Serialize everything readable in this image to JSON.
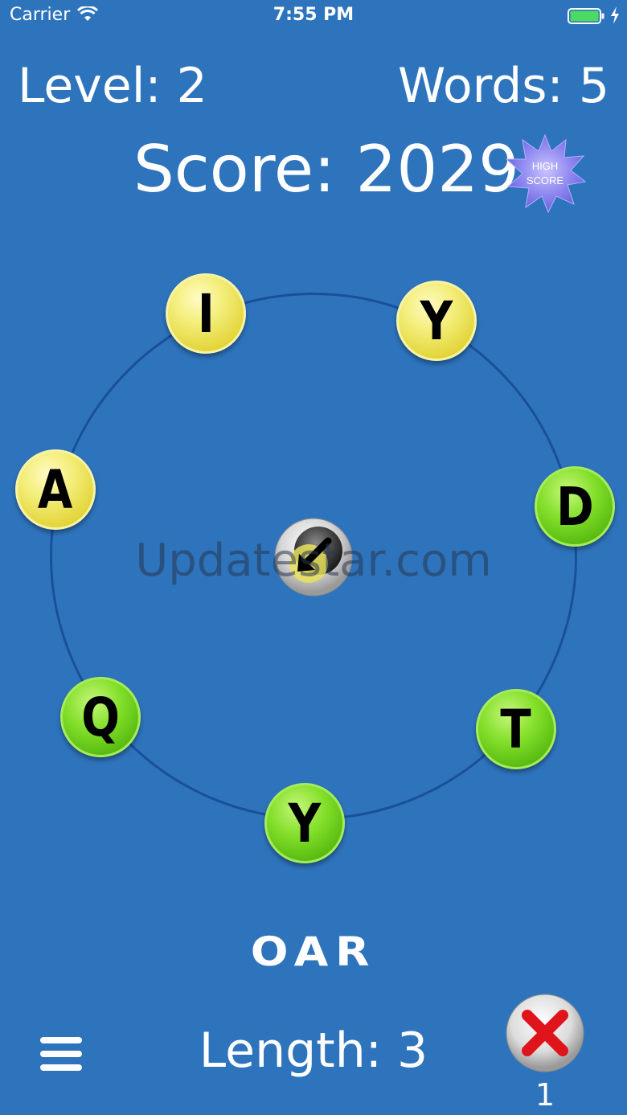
{
  "status_bar": {
    "carrier": "Carrier",
    "time": "7:55 PM",
    "battery_color": "#4cd964"
  },
  "stats": {
    "level": "Level: 2",
    "words": "Words: 5",
    "score": "Score: 2029",
    "high_score_line1": "HIGH",
    "high_score_line2": "SCORE"
  },
  "tiles": [
    {
      "letter": "I",
      "color": "yellow"
    },
    {
      "letter": "Y",
      "color": "yellow"
    },
    {
      "letter": "D",
      "color": "green"
    },
    {
      "letter": "T",
      "color": "green"
    },
    {
      "letter": "Y",
      "color": "green"
    },
    {
      "letter": "Q",
      "color": "green"
    },
    {
      "letter": "A",
      "color": "yellow"
    }
  ],
  "watermark": "Updatestar.com",
  "current_word": "OAR",
  "length": "Length: 3",
  "cancel_count": "1",
  "colors": {
    "background": "#2e74bd",
    "ring": "#1a4f9a",
    "tile_yellow": "#f4ee7c",
    "tile_green": "#83df2a",
    "cancel_red": "#e0141b"
  }
}
